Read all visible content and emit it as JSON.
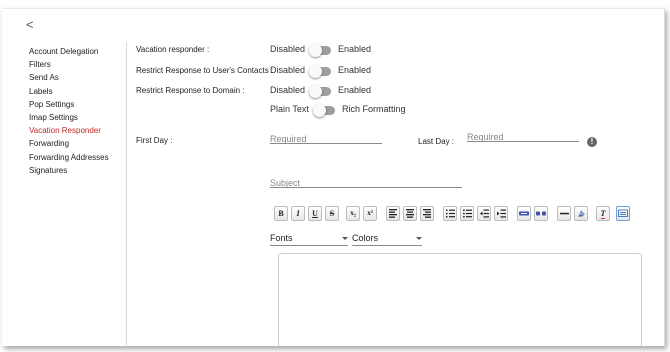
{
  "nav": {
    "back_symbol": "<"
  },
  "sidebar": {
    "items": [
      {
        "label": "Account Delegation"
      },
      {
        "label": "Filters"
      },
      {
        "label": "Send As"
      },
      {
        "label": "Labels"
      },
      {
        "label": "Pop Settings"
      },
      {
        "label": "Imap Settings"
      },
      {
        "label": "Vacation Responder",
        "active": true
      },
      {
        "label": "Forwarding"
      },
      {
        "label": "Forwarding Addresses"
      },
      {
        "label": "Signatures"
      }
    ]
  },
  "form": {
    "vacation_responder": {
      "label": "Vacation responder :",
      "off": "Disabled",
      "on": "Enabled",
      "enabled": false
    },
    "restrict_contacts": {
      "label": "Restrict Response to User's Contacts :",
      "off": "Disabled",
      "on": "Enabled",
      "enabled": false
    },
    "restrict_domain": {
      "label": "Restrict Response to Domain :",
      "off": "Disabled",
      "on": "Enabled",
      "enabled": false
    },
    "format": {
      "off": "Plain Text",
      "on": "Rich Formatting",
      "enabled": false
    },
    "first_day": {
      "label": "First Day :",
      "placeholder": "Required",
      "value": ""
    },
    "last_day": {
      "label": "Last Day :",
      "placeholder": "Required",
      "value": ""
    },
    "info_symbol": "!",
    "subject": {
      "placeholder": "Subject",
      "value": ""
    }
  },
  "toolbar": {
    "bold": "B",
    "italic": "I",
    "underline": "U",
    "strike": "S",
    "subscript": "x₂",
    "superscript": "x²",
    "clear_format": "T"
  },
  "editor": {
    "font_select": "Fonts",
    "color_select": "Colors",
    "body": ""
  },
  "colors": {
    "active_nav": "#c62828",
    "toggle_track": "#9e9e9e",
    "link_button_blue": "#3f51b5"
  }
}
